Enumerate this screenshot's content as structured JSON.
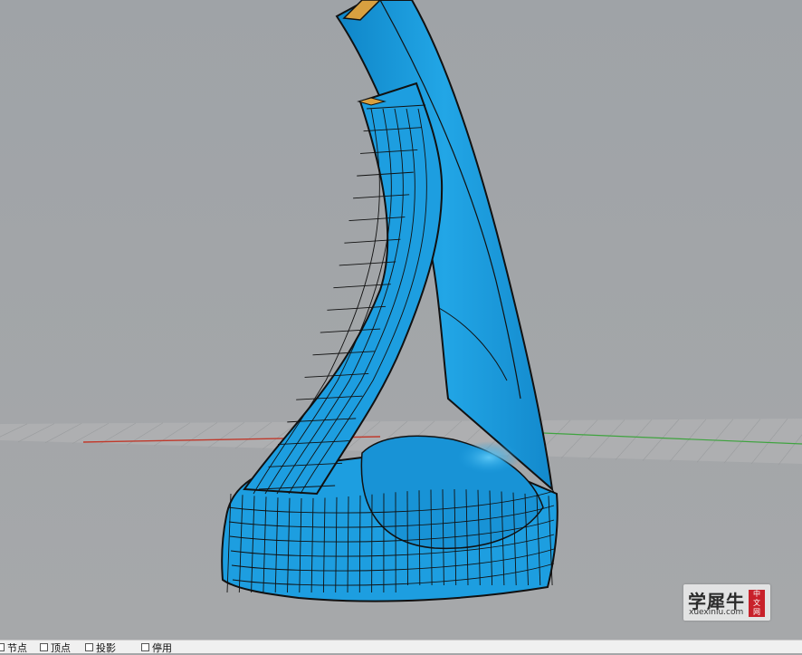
{
  "viewport": {
    "background_color": "#a4a6a8",
    "surface_color": "#1d9ee0",
    "edge_color": "#111111",
    "axis_x_color": "#c0392b",
    "axis_y_color": "#3fa33f",
    "cut_face_color": "#d8a040"
  },
  "watermark": {
    "title": "学犀牛",
    "url": "xuexiniu.com",
    "seal": [
      "中",
      "文",
      "网"
    ]
  },
  "statusbar": {
    "osnaps": [
      {
        "label": "节点",
        "checked": false
      },
      {
        "label": "顶点",
        "checked": false
      },
      {
        "label": "投影",
        "checked": false
      },
      {
        "label": "停用",
        "checked": false
      }
    ]
  }
}
